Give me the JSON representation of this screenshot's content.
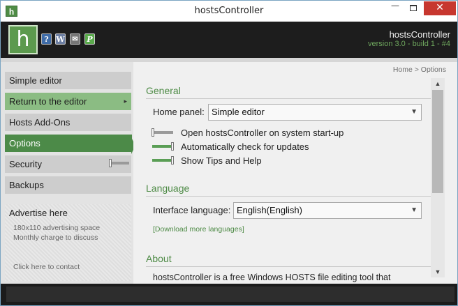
{
  "window": {
    "title": "hostsController",
    "app_icon_letter": "h",
    "controls": {
      "minimize": "—",
      "close": "✕"
    }
  },
  "header": {
    "logo_letter": "h",
    "icons": [
      {
        "name": "help-icon",
        "glyph": "?"
      },
      {
        "name": "wiki-icon",
        "glyph": "W"
      },
      {
        "name": "mail-icon",
        "glyph": "✉"
      },
      {
        "name": "paypal-icon",
        "glyph": "P"
      }
    ],
    "brand_name": "hostsController",
    "version": "version 3.0 - build 1 - #4",
    "accent_color": "#4c8a48"
  },
  "sidebar": {
    "items": [
      {
        "label": "Simple editor"
      },
      {
        "label": "Return to the editor",
        "arrow": "▸"
      },
      {
        "label": "Hosts Add-Ons"
      },
      {
        "label": "Options"
      },
      {
        "label": "Security"
      },
      {
        "label": "Backups"
      }
    ],
    "ad": {
      "title": "Advertise here",
      "line1": "180x110 advertising space",
      "line2": "Monthly charge to discuss",
      "contact": "Click here to contact"
    }
  },
  "main": {
    "breadcrumb": "Home > Options",
    "general": {
      "title": "General",
      "home_panel_label": "Home panel:",
      "home_panel_value": "Simple editor",
      "options": [
        {
          "label": "Open hostsController on system start-up",
          "enabled": false
        },
        {
          "label": "Automatically check for updates",
          "enabled": true
        },
        {
          "label": "Show Tips and Help",
          "enabled": true
        }
      ]
    },
    "language": {
      "title": "Language",
      "interface_label": "Interface language:",
      "interface_value": "English(English)",
      "download_link": "[Download more languages]"
    },
    "about": {
      "title": "About",
      "text": "hostsController is a free Windows HOSTS file editing tool that"
    }
  },
  "scrollbar": {
    "up": "▲",
    "down": "▼"
  }
}
